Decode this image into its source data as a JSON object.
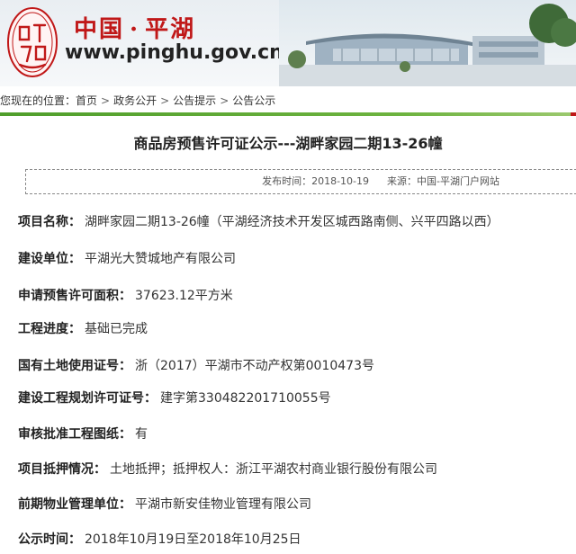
{
  "header": {
    "site_name_left": "中国",
    "site_name_dot": "·",
    "site_name_right": "平湖",
    "url": "www.pinghu.gov.cn",
    "seal_icon": "pinghu-seal-logo",
    "colors": {
      "brand_red": "#c01818",
      "green_bar": "#4f9e2b"
    }
  },
  "breadcrumb": {
    "prefix": "您现在的位置：",
    "items": [
      "首页",
      "政务公开",
      "公告提示",
      "公告公示"
    ],
    "separator": ">"
  },
  "article": {
    "title": "商品房预售许可证公示---湖畔家园二期13-26幢",
    "publish_label": "发布时间：",
    "publish_date": "2018-10-19",
    "source_label": "来源：",
    "source": "中国-平湖门户网站"
  },
  "fields": [
    {
      "label": "项目名称：",
      "value": "湖畔家园二期13-26幢（平湖经济技术开发区城西路南侧、兴平四路以西）"
    },
    {
      "label": "建设单位：",
      "value": "平湖光大赞城地产有限公司"
    },
    {
      "label": "申请预售许可面积：",
      "value": "37623.12平方米"
    },
    {
      "label": "工程进度：",
      "value": "基础已完成"
    },
    {
      "label": "国有土地使用证号：",
      "value": "浙（2017）平湖市不动产权第0010473号"
    },
    {
      "label": "建设工程规划许可证号：",
      "value": "建字第330482201710055号"
    },
    {
      "label": "审核批准工程图纸：",
      "value": "有"
    },
    {
      "label": "项目抵押情况：",
      "value": "土地抵押；抵押权人：浙江平湖农村商业银行股份有限公司"
    },
    {
      "label": "前期物业管理单位：",
      "value": "平湖市新安佳物业管理有限公司"
    },
    {
      "label": "公示时间：",
      "value": "2018年10月19日至2018年10月25日"
    }
  ]
}
